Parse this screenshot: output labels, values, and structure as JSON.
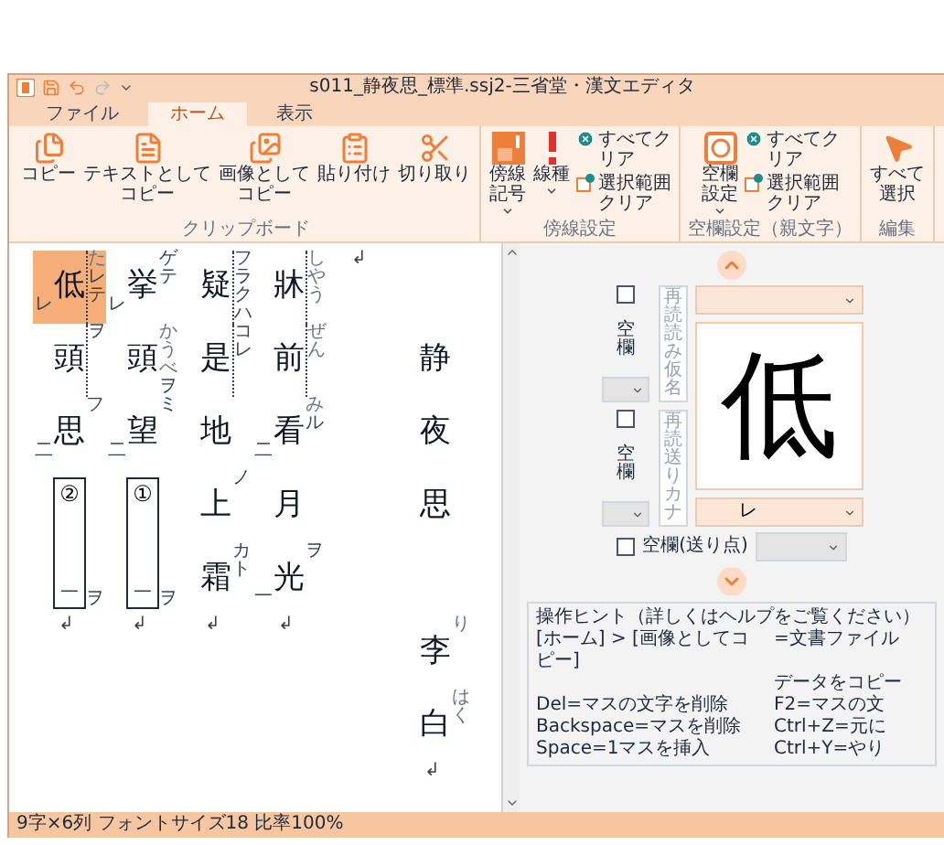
{
  "window": {
    "title": "s011_静夜思_標準.ssj2-三省堂・漢文エディタ"
  },
  "tabs": [
    {
      "label": "ファイル",
      "selected": false
    },
    {
      "label": "ホーム",
      "selected": true
    },
    {
      "label": "表示",
      "selected": false
    }
  ],
  "ribbon": [
    {
      "label": "クリップボード",
      "items": [
        {
          "kind": "copy",
          "label": "コピー",
          "dropdown": false
        },
        {
          "kind": "text-copy",
          "label": "テキストとしてコピー",
          "dropdown": false
        },
        {
          "kind": "image-copy",
          "label": "画像としてコピー",
          "dropdown": false
        },
        {
          "kind": "paste",
          "label": "貼り付け",
          "dropdown": false
        },
        {
          "kind": "cut",
          "label": "切り取り",
          "dropdown": false
        }
      ]
    },
    {
      "label": "傍線設定",
      "items": [
        {
          "kind": "sideline-mark",
          "label": "傍線記号",
          "dropdown": true
        },
        {
          "kind": "line-type",
          "label": "線種",
          "dropdown": true
        },
        {
          "kind": "clear-stack",
          "actions": [
            {
              "kind": "clear-all",
              "label": "すべてクリア"
            },
            {
              "kind": "clear-selection",
              "label": "選択範囲クリア"
            }
          ]
        }
      ]
    },
    {
      "label": "空欄設定（親文字）",
      "items": [
        {
          "kind": "blank-setting",
          "label": "空欄設定",
          "dropdown": true
        },
        {
          "kind": "clear-stack",
          "actions": [
            {
              "kind": "clear-all",
              "label": "すべてクリア"
            },
            {
              "kind": "clear-selection",
              "label": "選択範囲クリア"
            }
          ]
        }
      ]
    },
    {
      "label": "編集",
      "items": [
        {
          "kind": "select-all",
          "label": "すべて選択",
          "dropdown": false
        }
      ]
    }
  ],
  "editor": {
    "columns": [
      {
        "cells": [
          {
            "kind": "char",
            "char": "低",
            "ruby": "た",
            "okuri": "レテ",
            "kaeriten": "レ",
            "selected": true,
            "side_line": true
          },
          {
            "kind": "char",
            "char": "頭",
            "okuri": "ヲ",
            "selected": false,
            "side_line": true
          },
          {
            "kind": "char",
            "char": "思",
            "okuri": "フ",
            "kaeriten": "二",
            "selected": false,
            "side_line": false
          },
          {
            "kind": "blank",
            "label": "②",
            "kaeriten": "一",
            "okuri": "ヲ",
            "selected": false
          }
        ],
        "end_mark": "↲"
      },
      {
        "cells": [
          {
            "kind": "char",
            "char": "挙",
            "okuri": "ゲテ",
            "kaeriten": "レ",
            "selected": false,
            "side_line": false
          },
          {
            "kind": "char",
            "char": "頭",
            "ruby": "かうべ",
            "okuri": "ヲ",
            "selected": false,
            "side_line": false
          },
          {
            "kind": "char",
            "char": "望",
            "okuri": "ミ",
            "kaeriten": "二",
            "selected": false,
            "side_line": false
          },
          {
            "kind": "blank",
            "label": "①",
            "kaeriten": "一",
            "okuri": "ヲ",
            "selected": false
          }
        ],
        "end_mark": "↲"
      },
      {
        "cells": [
          {
            "kind": "char",
            "char": "疑",
            "okuri": "フラクハ",
            "selected": false,
            "side_line": true
          },
          {
            "kind": "char",
            "char": "是",
            "okuri": "コレ",
            "selected": false,
            "side_line": true
          },
          {
            "kind": "char",
            "char": "地",
            "selected": false,
            "side_line": false
          },
          {
            "kind": "char",
            "char": "上",
            "okuri": "ノ",
            "selected": false,
            "side_line": false
          },
          {
            "kind": "char",
            "char": "霜",
            "okuri": "カト",
            "selected": false,
            "side_line": false
          }
        ],
        "end_mark": "↲"
      },
      {
        "cells": [
          {
            "kind": "char",
            "char": "牀",
            "ruby": "しやう",
            "selected": false,
            "side_line": true
          },
          {
            "kind": "char",
            "char": "前",
            "ruby": "ぜん",
            "selected": false,
            "side_line": true
          },
          {
            "kind": "char",
            "char": "看",
            "ruby": "み",
            "okuri": "ル",
            "kaeriten": "二",
            "selected": false,
            "side_line": false
          },
          {
            "kind": "char",
            "char": "月",
            "selected": false,
            "side_line": false
          },
          {
            "kind": "char",
            "char": "光",
            "okuri": "ヲ",
            "kaeriten": "一",
            "selected": false,
            "side_line": false
          }
        ],
        "end_mark": "↲"
      },
      {
        "end_mark": "↲"
      },
      {
        "cells": [
          {
            "kind": "empty"
          },
          {
            "kind": "char",
            "char": "静",
            "selected": false,
            "side_line": false
          },
          {
            "kind": "char",
            "char": "夜",
            "selected": false,
            "side_line": false
          },
          {
            "kind": "char",
            "char": "思",
            "selected": false,
            "side_line": false
          },
          {
            "kind": "empty"
          },
          {
            "kind": "char",
            "char": "李",
            "ruby": "り",
            "selected": false,
            "side_line": false
          },
          {
            "kind": "char",
            "char": "白",
            "ruby": "はく",
            "selected": false,
            "side_line": false
          }
        ],
        "end_mark": "↲"
      }
    ]
  },
  "cell_panel": {
    "reading_fields": [
      {
        "placeholder": "再読読み仮名",
        "blank_label": "空欄",
        "checked": false
      },
      {
        "placeholder": "再読送りカナ",
        "blank_label": "空欄",
        "checked": false
      }
    ],
    "character": "低",
    "kaeriten_value": "レ",
    "okuri_blank": {
      "label": "空欄(送り点)",
      "checked": false
    }
  },
  "hints": {
    "title": "操作ヒント（詳しくはヘルプをご覧ください）",
    "rows": [
      {
        "left": "[ホーム] > [画像としてコピー]",
        "right": "=文書ファイル"
      },
      {
        "right": "データをコピー"
      },
      {
        "left": "Del=マスの文字を削除",
        "right": "F2=マスの文"
      },
      {
        "left": "Backspace=マスを削除",
        "right": "Ctrl+Z=元に"
      },
      {
        "left": "Space=1マスを挿入",
        "right": "Ctrl+Y=やり"
      }
    ]
  },
  "status_bar": "9字×6列 フォントサイズ18 比率100%"
}
